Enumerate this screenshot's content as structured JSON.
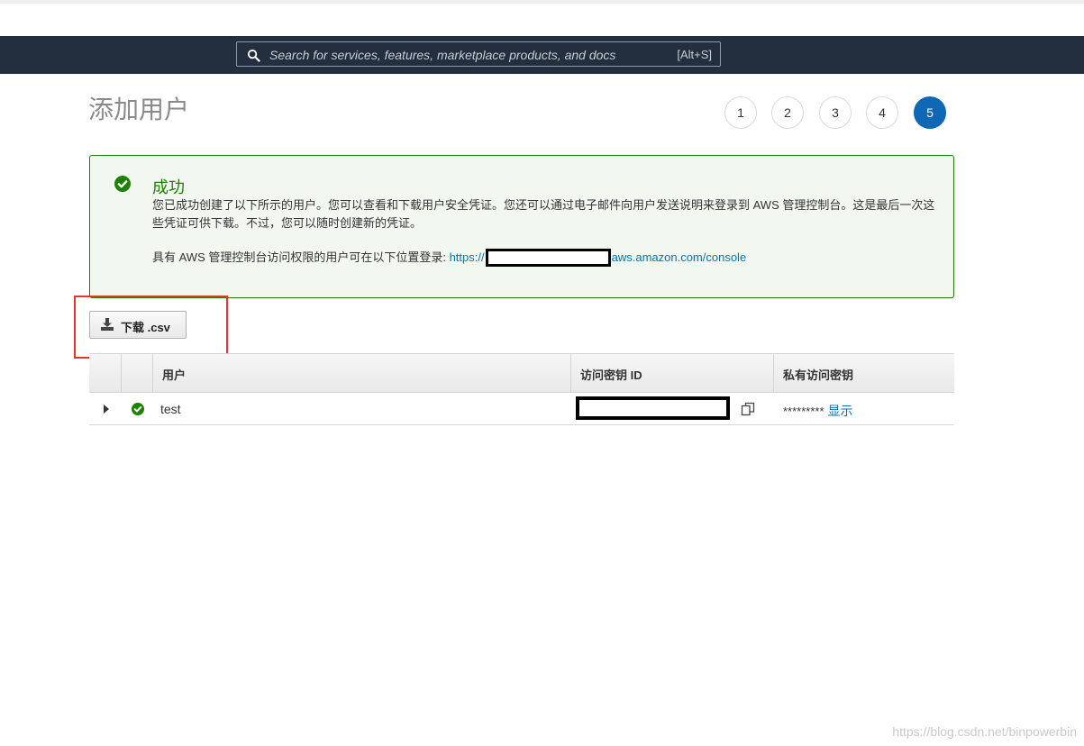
{
  "search": {
    "placeholder": "Search for services, features, marketplace products, and docs",
    "shortcut": "[Alt+S]"
  },
  "page": {
    "title": "添加用户"
  },
  "steps": [
    "1",
    "2",
    "3",
    "4",
    "5"
  ],
  "current_step": "5",
  "alert": {
    "title": "成功",
    "description": "您已成功创建了以下所示的用户。您可以查看和下载用户安全凭证。您还可以通过电子邮件向用户发送说明来登录到 AWS 管理控制台。这是最后一次这些凭证可供下载。不过，您可以随时创建新的凭证。",
    "login_prefix": "具有 AWS 管理控制台访问权限的用户可在以下位置登录: ",
    "login_url_start": "https://",
    "login_url_end": "aws.amazon.com/console"
  },
  "download_button": {
    "label": "下载 .csv"
  },
  "table": {
    "headers": {
      "user": "用户",
      "access_key_id": "访问密钥 ID",
      "secret_access_key": "私有访问密钥"
    },
    "rows": [
      {
        "user": "test",
        "secret_masked": "*********",
        "show_label": "显示"
      }
    ]
  },
  "watermark": "https://blog.csdn.net/binpowerbin",
  "colors": {
    "nav": "#232f3e",
    "success": "#1d8102",
    "primary": "#0f68b5",
    "link": "#0073bb",
    "highlight": "#e8352b"
  }
}
